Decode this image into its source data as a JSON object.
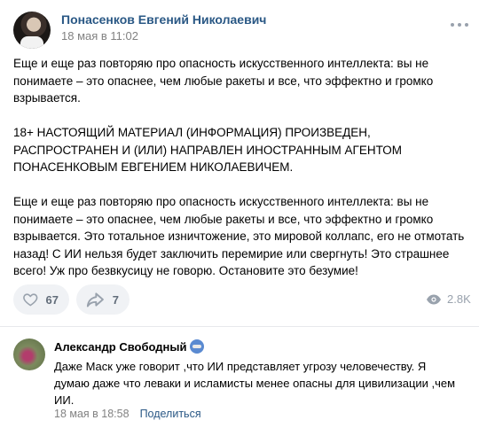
{
  "post": {
    "author": "Понасенков Евгений Николаевич",
    "date": "18 мая в 11:02",
    "paragraphs": [
      "Еще и еще раз повторяю про опасность искусственного интеллекта: вы не понимаете – это опаснее, чем любые ракеты и все, что эффектно и громко взрывается.",
      "18+ НАСТОЯЩИЙ МАТЕРИАЛ (ИНФОРМАЦИЯ) ПРОИЗВЕДЕН, РАСПРОСТРАНЕН И (ИЛИ) НАПРАВЛЕН ИНОСТРАННЫМ АГЕНТОМ ПОНАСЕНКОВЫМ ЕВГЕНИЕМ НИКОЛАЕВИЧЕМ.",
      "Еще и еще раз повторяю про опасность искусственного интеллекта: вы не понимаете – это опаснее, чем любые ракеты и все, что эффектно и громко взрывается. Это тотальное изничтожение, это мировой коллапс, его не отмотать назад! С ИИ нельзя будет заключить перемирие или свергнуть! Это страшнее всего! Уж про безвкусицу не говорю. Остановите это безумие!"
    ],
    "likes": "67",
    "shares": "7",
    "views": "2.8K"
  },
  "comment": {
    "author": "Александр Свободный",
    "text": "Даже Маск уже говорит ,что ИИ представляет угрозу человечеству. Я думаю даже что леваки и исламисты менее опасны для цивилизации ,чем ИИ.",
    "date": "18 мая в 18:58",
    "share_label": "Поделиться"
  },
  "icons": {
    "more": "more-dots-icon",
    "like": "heart-icon",
    "share": "share-arrow-icon",
    "views": "eye-icon",
    "badge": "profile-badge-icon"
  },
  "colors": {
    "link": "#2a5885",
    "muted": "#828282",
    "pill_bg": "#f0f2f5",
    "icon": "#99a2ad"
  }
}
